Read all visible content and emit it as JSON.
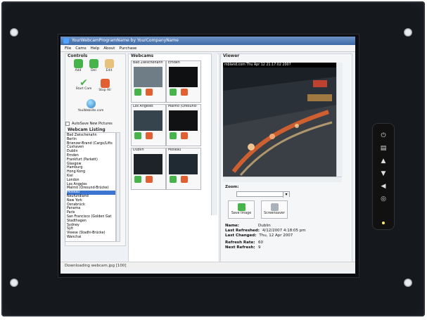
{
  "window": {
    "title": "YourWebcamProgramName by YourCompanyName"
  },
  "menu": [
    "File",
    "Cams",
    "Help",
    "About",
    "Purchase"
  ],
  "controls": {
    "title": "Controls",
    "buttons": [
      {
        "label": "Add",
        "icon": "add-icon"
      },
      {
        "label": "Del",
        "icon": "delete-icon"
      },
      {
        "label": "Edit",
        "icon": "edit-icon"
      },
      {
        "label": "Start Cam",
        "icon": "checkmark-icon"
      },
      {
        "label": "Stop All",
        "icon": "stop-icon"
      }
    ],
    "youtube_label": "YouWebsite.com",
    "autosave_label": "AutoSave New Pictures",
    "listing_title": "Webcam Listing",
    "listing": [
      "Bad Zwischenahn",
      "Berlin",
      "Brienzer-Brand (Cargo/Lifts",
      "Cuxhaven",
      "Dublin",
      "Emden",
      "Frankfurt (Parkett)",
      "Glasgow",
      "Hamburg",
      "Hong Kong",
      "Kiel",
      "London",
      "Los Angeles",
      "Malmö (Öresund-Brücke)",
      "Moskau",
      "Neufundland",
      "New York",
      "Osnabrück",
      "Panama",
      "Paris",
      "San Francisco (Golden Gat",
      "Stadthagen",
      "Sydney",
      "Sylt",
      "Vieese (Stadhi-Brücke)",
      "Wanchai"
    ],
    "selected_index": 14
  },
  "webcams": {
    "title": "Webcams",
    "items": [
      {
        "name": "Bad Zwischenahn"
      },
      {
        "name": "Emden"
      },
      {
        "name": "Los Angeles"
      },
      {
        "name": "Malmö (Öresund-"
      },
      {
        "name": "Dublin"
      },
      {
        "name": "Moskau"
      }
    ]
  },
  "viewer": {
    "title": "Viewer",
    "header": "mbland.com   Thu Apr 12 21:17:02 2007",
    "zoom_label": "Zoom:",
    "save_label": "Save Image",
    "screensaver_label": "Screensaver",
    "info": {
      "name_label": "Name:",
      "name_value": "Dublin",
      "last_refreshed_label": "Last Refreshed:",
      "last_refreshed_value": "4/12/2007 4:18:05 pm",
      "last_changed_label": "Last Changed:",
      "last_changed_value": "Thu, 12 Apr 2007",
      "refresh_rate_label": "Refresh Rate:",
      "refresh_rate_value": "60",
      "next_refresh_label": "Next Refresh:",
      "next_refresh_value": "9"
    }
  },
  "status": {
    "text": "Downloading webcam.jpg [100]"
  },
  "side_controls": {
    "icons": [
      "power-icon",
      "menu-icon",
      "up-icon",
      "down-icon",
      "left-icon",
      "auto-icon"
    ]
  }
}
